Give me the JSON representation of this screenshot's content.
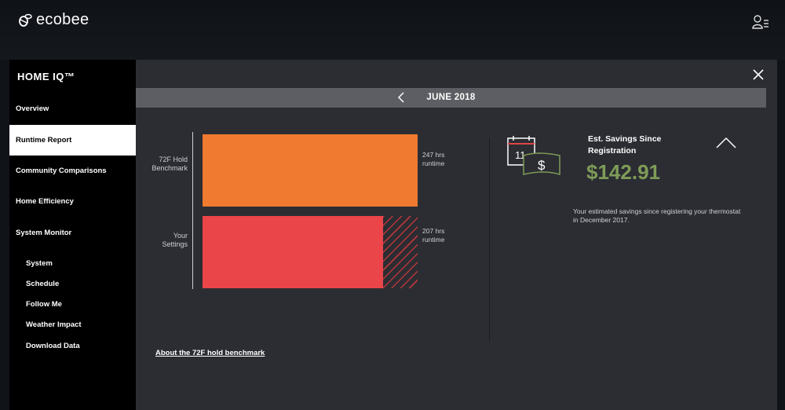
{
  "app": {
    "logo_text": "ecobee"
  },
  "sidebar": {
    "brand": "HOME IQ™",
    "items": [
      {
        "label": "Overview",
        "active": false
      },
      {
        "label": "Runtime Report",
        "active": true
      },
      {
        "label": "Community Comparisons",
        "active": false
      },
      {
        "label": "Home Efficiency",
        "active": false
      },
      {
        "label": "System Monitor",
        "active": false
      }
    ],
    "subitems": [
      "System",
      "Schedule",
      "Follow Me",
      "Weather Impact",
      "Download Data"
    ]
  },
  "report": {
    "month": "JUNE 2018",
    "bars": [
      {
        "label": "72F Hold\nBenchmark",
        "hours": 247,
        "value_text": "247 hrs\nruntime",
        "color": "#f07a30"
      },
      {
        "label": "Your\nSettings",
        "hours": 207,
        "value_text": "207 hrs\nruntime",
        "color": "#ea4549"
      }
    ],
    "about_link": "About the 72F hold benchmark"
  },
  "savings": {
    "title": "Est. Savings Since Registration",
    "amount": "$142.91",
    "description": "Your estimated savings since registering your thermostat in December 2017.",
    "calendar_day": "11",
    "accent": "#7f9c57"
  },
  "icons": [
    "bee-logo-icon",
    "user-menu-icon",
    "close-icon",
    "chevron-left-icon",
    "calendar-money-icon",
    "chevron-up-icon"
  ]
}
